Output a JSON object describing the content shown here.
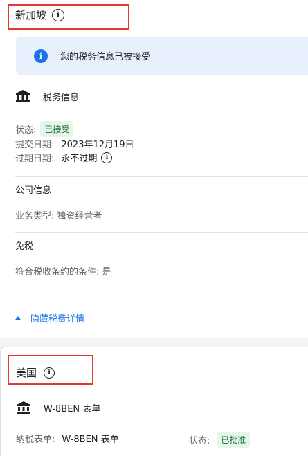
{
  "singapore": {
    "country": "新加坡",
    "banner_text": "您的税务信息已被接受",
    "section_title": "税务信息",
    "status_label": "状态:",
    "status_value": "已接受",
    "submit_label": "提交日期:",
    "submit_value": "2023年12月19日",
    "expiry_label": "过期日期:",
    "expiry_value": "永不过期",
    "company_heading": "公司信息",
    "business_type": "业务类型: 独资经营者",
    "exemption_heading": "免税",
    "treaty_eligible": "符合税收条约的条件: 是",
    "hide_details": "隐藏税费详情"
  },
  "usa": {
    "country": "美国",
    "section_title": "W-8BEN 表单",
    "form_label": "纳税表单:",
    "form_value": "W-8BEN 表单",
    "status_label": "状态:",
    "status_value": "已批准"
  },
  "colors": {
    "accent": "#1a73e8",
    "success_bg": "#e6f4ea",
    "success_text": "#137333",
    "highlight": "#e53935",
    "banner_bg": "#e8f0fe"
  }
}
